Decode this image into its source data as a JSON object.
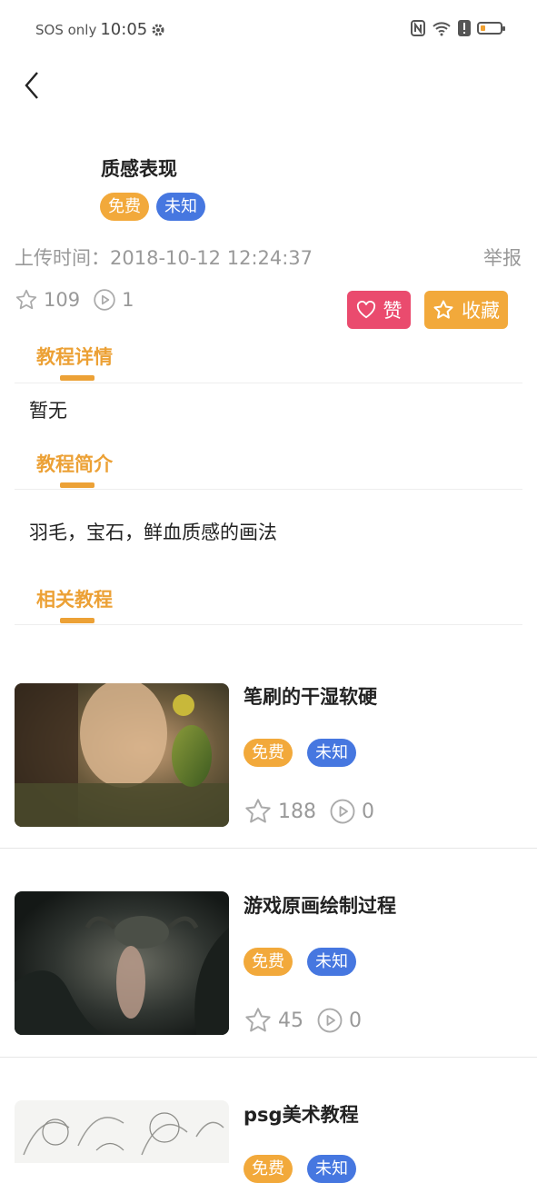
{
  "status_bar": {
    "sos": "SOS only",
    "time": "10:05"
  },
  "tutorial": {
    "title": "质感表现",
    "tags": [
      "免费",
      "未知"
    ],
    "upload_time": "上传时间：2018-10-12 12:24:37",
    "report": "举报",
    "favorites": "109",
    "plays": "1",
    "like_label": "赞",
    "favorite_label": "收藏"
  },
  "sections": {
    "detail_title": "教程详情",
    "detail_text": "暂无",
    "intro_title": "教程简介",
    "intro_text": "羽毛，宝石，鲜血质感的画法",
    "related_title": "相关教程"
  },
  "related": [
    {
      "title": "笔刷的干湿软硬",
      "tags": [
        "免费",
        "未知"
      ],
      "favorites": "188",
      "plays": "0"
    },
    {
      "title": "游戏原画绘制过程",
      "tags": [
        "免费",
        "未知"
      ],
      "favorites": "45",
      "plays": "0"
    },
    {
      "title": "psg美术教程",
      "tags": [
        "免费",
        "未知"
      ],
      "favorites": "",
      "plays": ""
    }
  ],
  "colors": {
    "accent": "#eca136",
    "free_tag": "#f2a93b",
    "unknown_tag": "#4677e0",
    "like": "#ea4b6e"
  },
  "icons": [
    "back-icon",
    "gear-icon",
    "nfc-icon",
    "wifi-icon",
    "alert-icon",
    "battery-icon",
    "star-icon",
    "play-icon",
    "heart-icon"
  ]
}
